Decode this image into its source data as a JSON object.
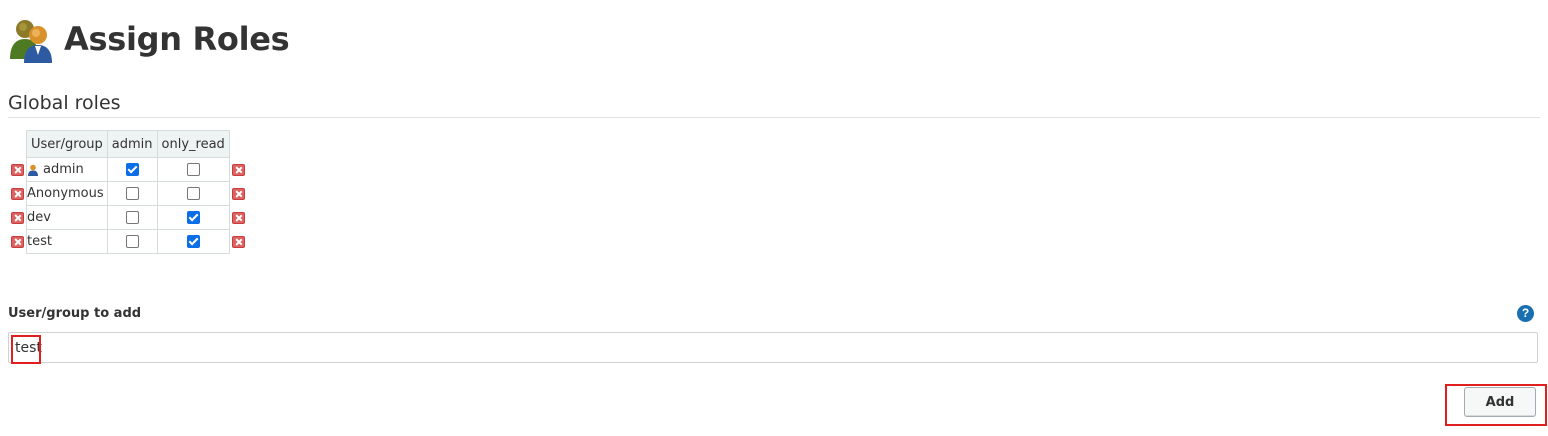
{
  "header": {
    "title": "Assign Roles",
    "icon": "users-icon"
  },
  "global_roles": {
    "section_title": "Global roles",
    "columns": [
      "User/group",
      "admin",
      "only_read"
    ],
    "rows": [
      {
        "name": "admin",
        "icon": "user-icon",
        "admin": true,
        "only_read": false
      },
      {
        "name": "Anonymous",
        "admin": false,
        "only_read": false
      },
      {
        "name": "dev",
        "admin": false,
        "only_read": true
      },
      {
        "name": "test",
        "admin": false,
        "only_read": true
      }
    ]
  },
  "add_form": {
    "label": "User/group to add",
    "help_label": "?",
    "input_value": "test",
    "button_label": "Add"
  },
  "colors": {
    "highlight": "#e02020",
    "accent": "#1a6fb0",
    "checked": "#0a6ee6"
  }
}
